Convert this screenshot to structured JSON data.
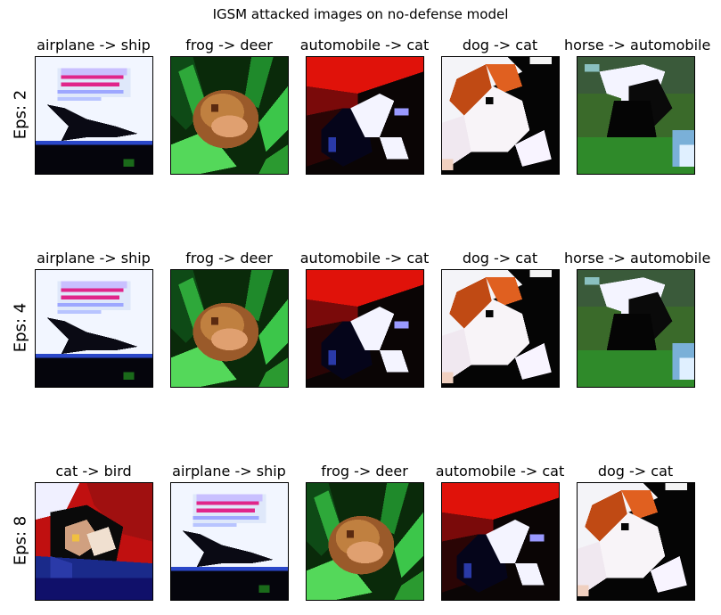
{
  "suptitle": "IGSM attacked images on no-defense model",
  "rows": [
    {
      "label": "Eps: 2",
      "cells": [
        {
          "title": "airplane -> ship",
          "image": "airplane"
        },
        {
          "title": "frog -> deer",
          "image": "frog"
        },
        {
          "title": "automobile -> cat",
          "image": "automobile"
        },
        {
          "title": "dog -> cat",
          "image": "dog"
        },
        {
          "title": "horse -> automobile",
          "image": "horse"
        }
      ]
    },
    {
      "label": "Eps: 4",
      "cells": [
        {
          "title": "airplane -> ship",
          "image": "airplane"
        },
        {
          "title": "frog -> deer",
          "image": "frog"
        },
        {
          "title": "automobile -> cat",
          "image": "automobile"
        },
        {
          "title": "dog -> cat",
          "image": "dog"
        },
        {
          "title": "horse -> automobile",
          "image": "horse"
        }
      ]
    },
    {
      "label": "Eps: 8",
      "cells": [
        {
          "title": "cat -> bird",
          "image": "cat"
        },
        {
          "title": "airplane -> ship",
          "image": "airplane"
        },
        {
          "title": "frog -> deer",
          "image": "frog"
        },
        {
          "title": "automobile -> cat",
          "image": "automobile"
        },
        {
          "title": "dog -> cat",
          "image": "dog"
        }
      ]
    }
  ]
}
